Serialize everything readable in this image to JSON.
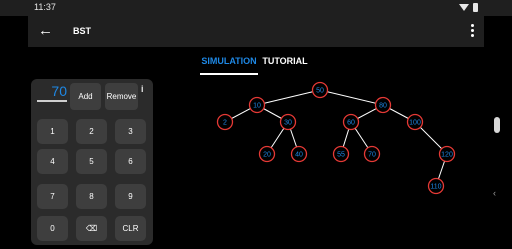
{
  "status_bar": {
    "time": "11:37"
  },
  "app_bar": {
    "title": "BST",
    "back_glyph": "←"
  },
  "tabs": [
    {
      "label": "SIMULATION",
      "selected": true
    },
    {
      "label": "TUTORIAL",
      "selected": false
    }
  ],
  "input": {
    "value": "70"
  },
  "buttons": {
    "add": "Add",
    "remove": "Remove",
    "info": "i"
  },
  "keys": [
    "1",
    "2",
    "3",
    "4",
    "5",
    "6",
    "7",
    "8",
    "9",
    "0",
    "backspace-icon",
    "CLR"
  ],
  "key_labels": {
    "clear": "CLR",
    "backspace_glyph": "⌫"
  },
  "tree": {
    "nodes": [
      {
        "id": "n50",
        "label": "50"
      },
      {
        "id": "n10",
        "label": "10"
      },
      {
        "id": "n80",
        "label": "80"
      },
      {
        "id": "n2",
        "label": "2"
      },
      {
        "id": "n30",
        "label": "30"
      },
      {
        "id": "n60",
        "label": "60"
      },
      {
        "id": "n100",
        "label": "100"
      },
      {
        "id": "n20",
        "label": "20"
      },
      {
        "id": "n40",
        "label": "40"
      },
      {
        "id": "n55",
        "label": "55"
      },
      {
        "id": "n70",
        "label": "70"
      },
      {
        "id": "n120",
        "label": "120"
      },
      {
        "id": "n110",
        "label": "110"
      }
    ],
    "edges": [
      [
        "n50",
        "n10"
      ],
      [
        "n50",
        "n80"
      ],
      [
        "n10",
        "n2"
      ],
      [
        "n10",
        "n30"
      ],
      [
        "n30",
        "n20"
      ],
      [
        "n30",
        "n40"
      ],
      [
        "n80",
        "n60"
      ],
      [
        "n80",
        "n100"
      ],
      [
        "n60",
        "n55"
      ],
      [
        "n60",
        "n70"
      ],
      [
        "n100",
        "n120"
      ],
      [
        "n120",
        "n110"
      ]
    ]
  },
  "colors": {
    "accent": "#1e88e5",
    "node_ring": "#e53935",
    "edge": "#ffffff",
    "bar": "#1f1f1f",
    "key": "#3e3e3e"
  },
  "icons": [
    "back-arrow-icon",
    "more-vert-icon",
    "wifi-icon",
    "battery-icon",
    "info-icon",
    "backspace-icon",
    "chevron-left-icon"
  ]
}
